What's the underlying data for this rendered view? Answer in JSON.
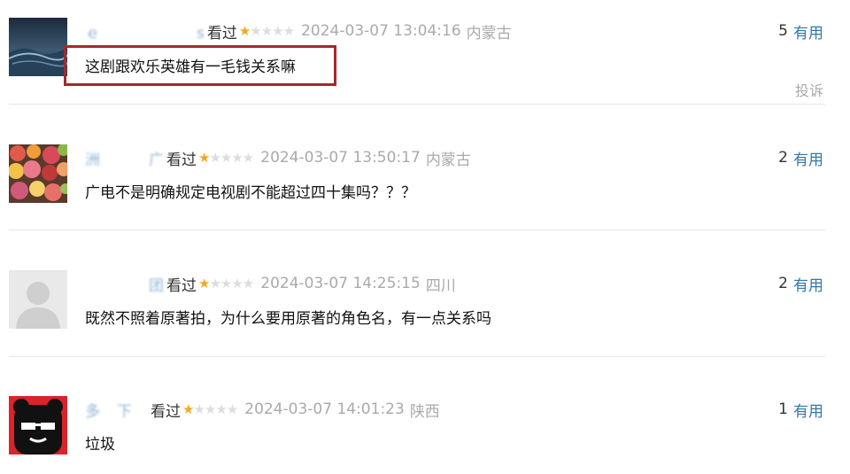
{
  "comments": [
    {
      "username": "ｅ　　　　　　s",
      "watched": "看过",
      "rating": 1,
      "time": "2024-03-07 13:04:16",
      "location": "内蒙古",
      "useful_count": "5",
      "useful_label": "有用",
      "content": "这剧跟欢乐英雄有一毛钱关系嘛",
      "report": "投诉"
    },
    {
      "username": "洲　　　广",
      "watched": "看过",
      "rating": 1,
      "time": "2024-03-07 13:50:17",
      "location": "内蒙古",
      "useful_count": "2",
      "useful_label": "有用",
      "content": "广电不是明确规定电视剧不能超过四十集吗？？？"
    },
    {
      "username": "　　　　团",
      "watched": "看过",
      "rating": 1,
      "time": "2024-03-07 14:25:15",
      "location": "四川",
      "useful_count": "2",
      "useful_label": "有用",
      "content": "既然不照着原著拍，为什么要用原著的角色名，有一点关系吗"
    },
    {
      "username": "多　下　",
      "watched": "看过",
      "rating": 1,
      "time": "2024-03-07 14:01:23",
      "location": "陕西",
      "useful_count": "1",
      "useful_label": "有用",
      "content": "垃圾"
    }
  ],
  "colors": {
    "link": "#3377aa",
    "star_on": "#f5a623",
    "star_off": "#dddddd",
    "highlight_box": "#a32a2a"
  },
  "icons": {
    "avatar_1": "stormy-sea-avatar",
    "avatar_2": "fruit-avatar",
    "avatar_3": "default-user-avatar",
    "avatar_4": "black-bear-sunglasses-avatar"
  }
}
